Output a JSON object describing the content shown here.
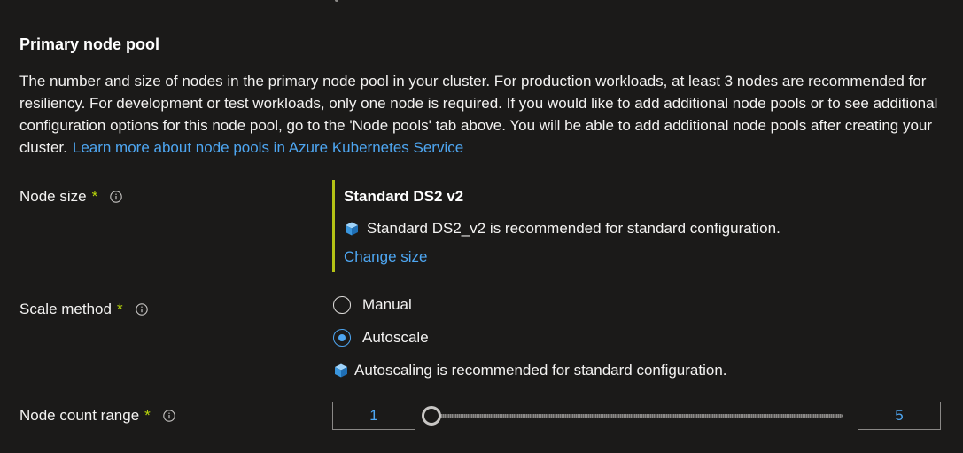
{
  "section": {
    "title": "Primary node pool",
    "description": "The number and size of nodes in the primary node pool in your cluster. For production workloads, at least 3 nodes are recommended for resiliency. For development or test workloads, only one node is required. If you would like to add additional node pools or to see additional configuration options for this node pool, go to the 'Node pools' tab above. You will be able to add additional node pools after creating your cluster.",
    "learn_more_link": "Learn more about node pools in Azure Kubernetes Service"
  },
  "node_size": {
    "label": "Node size",
    "required_marker": "*",
    "icon": "info-icon",
    "selected_size": "Standard DS2 v2",
    "recommendation": "Standard DS2_v2 is recommended for standard configuration.",
    "recommendation_icon": "cube-icon",
    "change_link": "Change size"
  },
  "scale_method": {
    "label": "Scale method",
    "required_marker": "*",
    "icon": "info-icon",
    "options": [
      {
        "label": "Manual",
        "selected": false
      },
      {
        "label": "Autoscale",
        "selected": true
      }
    ],
    "recommendation": "Autoscaling is recommended for standard configuration.",
    "recommendation_icon": "cube-icon"
  },
  "node_count_range": {
    "label": "Node count range",
    "required_marker": "*",
    "icon": "info-icon",
    "min": "1",
    "max": "5",
    "slider_position": 0
  },
  "colors": {
    "background": "#1b1a19",
    "link": "#4ea6f1",
    "required": "#bad80a",
    "info_bar": "#b4c215"
  }
}
